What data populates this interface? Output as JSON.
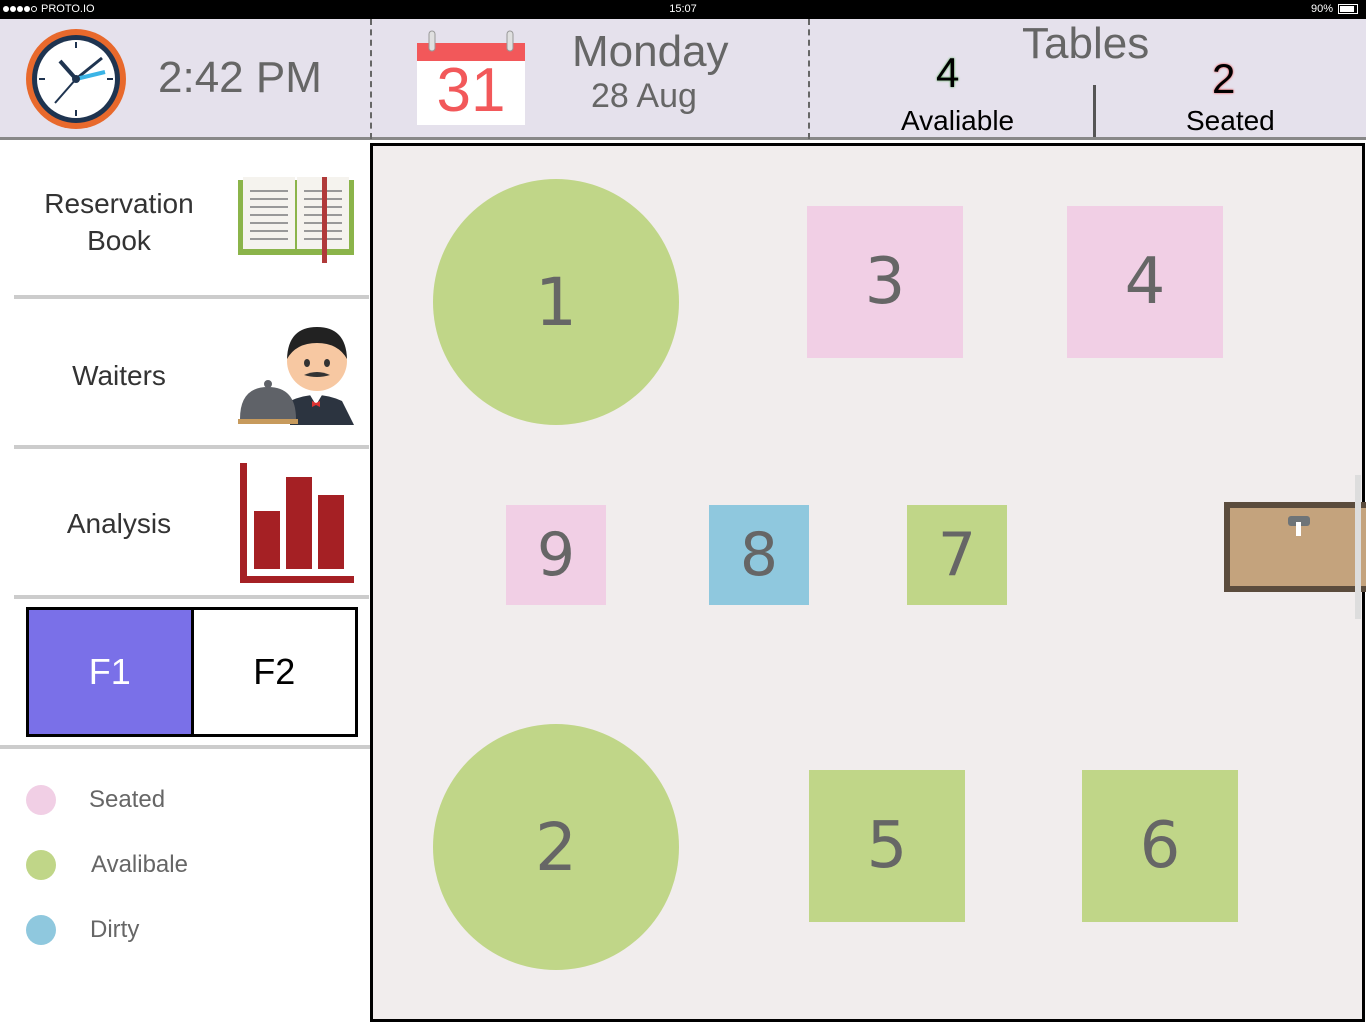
{
  "status_bar": {
    "carrier": "PROTO.IO",
    "time": "15:07",
    "battery": "90%"
  },
  "header": {
    "clock_time": "2:42 PM",
    "calendar_day_number": "31",
    "day_name": "Monday",
    "date": "28 Aug",
    "tables_title": "Tables",
    "available_count": "4",
    "available_label": "Avaliable",
    "seated_count": "2",
    "seated_label": "Seated"
  },
  "sidebar": {
    "items": [
      {
        "label_line1": "Reservation",
        "label_line2": "Book",
        "icon": "book-icon"
      },
      {
        "label": "Waiters",
        "icon": "waiter-icon"
      },
      {
        "label": "Analysis",
        "icon": "bar-chart-icon"
      }
    ],
    "floors": [
      {
        "label": "F1",
        "active": true
      },
      {
        "label": "F2",
        "active": false
      }
    ],
    "legend": [
      {
        "label": "Seated",
        "color": "#f1cfe5"
      },
      {
        "label": "Avalibale",
        "color": "#c0d688"
      },
      {
        "label": "Dirty",
        "color": "#8fc8de"
      }
    ]
  },
  "tables": [
    {
      "number": "1",
      "status": "available",
      "shape": "round"
    },
    {
      "number": "3",
      "status": "seated",
      "shape": "square"
    },
    {
      "number": "4",
      "status": "seated",
      "shape": "square"
    },
    {
      "number": "9",
      "status": "seated",
      "shape": "square"
    },
    {
      "number": "8",
      "status": "dirty",
      "shape": "square"
    },
    {
      "number": "7",
      "status": "available",
      "shape": "square"
    },
    {
      "number": "2",
      "status": "available",
      "shape": "round"
    },
    {
      "number": "5",
      "status": "available",
      "shape": "square"
    },
    {
      "number": "6",
      "status": "available",
      "shape": "square"
    }
  ],
  "colors": {
    "seated": "#f1cfe5",
    "available": "#c0d688",
    "dirty": "#8fc8de",
    "active_floor": "#7a70e8"
  }
}
